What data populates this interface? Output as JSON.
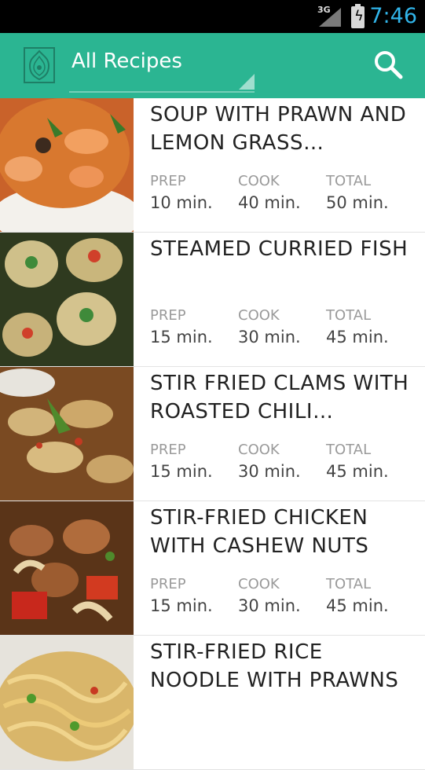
{
  "status": {
    "network": "3G",
    "time": "7:46"
  },
  "action_bar": {
    "title": "All Recipes"
  },
  "labels": {
    "prep": "PREP",
    "cook": "COOK",
    "total": "TOTAL"
  },
  "recipes": [
    {
      "name": "SOUP WITH PRAWN AND LEMON GRASS…",
      "prep": "10 min.",
      "cook": "40 min.",
      "total": "50 min."
    },
    {
      "name": "STEAMED CURRIED FISH",
      "prep": "15 min.",
      "cook": "30 min.",
      "total": "45 min."
    },
    {
      "name": "STIR FRIED CLAMS WITH ROASTED CHILI…",
      "prep": "15 min.",
      "cook": "30 min.",
      "total": "45 min."
    },
    {
      "name": "STIR-FRIED CHICKEN WITH CASHEW NUTS",
      "prep": "15 min.",
      "cook": "30 min.",
      "total": "45 min."
    },
    {
      "name": "STIR-FRIED RICE NOODLE WITH PRAWNS",
      "prep": "",
      "cook": "",
      "total": ""
    }
  ],
  "colors": {
    "action_bar": "#2bb592",
    "status_time": "#31b5ea"
  },
  "icons": {
    "app_logo": "thai-ornament-logo-icon",
    "search": "search-icon"
  }
}
